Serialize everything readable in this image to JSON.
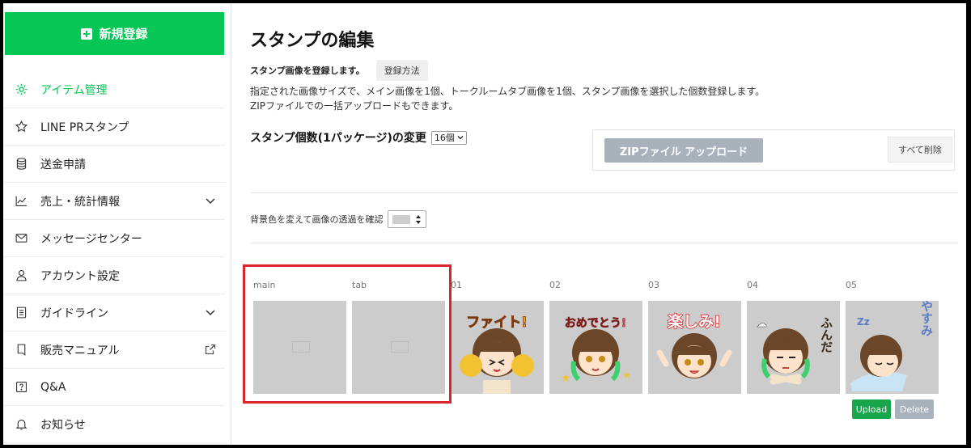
{
  "sidebar": {
    "new_button": "新規登録",
    "items": [
      {
        "label": "アイテム管理",
        "icon": "gear-icon",
        "active": true
      },
      {
        "label": "LINE PRスタンプ",
        "icon": "star-icon"
      },
      {
        "label": "送金申請",
        "icon": "database-icon"
      },
      {
        "label": "売上・統計情報",
        "icon": "chart-icon",
        "trail": "chevron-down-icon"
      },
      {
        "label": "メッセージセンター",
        "icon": "mail-icon"
      },
      {
        "label": "アカウント設定",
        "icon": "person-icon"
      },
      {
        "label": "ガイドライン",
        "icon": "list-doc-icon",
        "trail": "chevron-down-icon"
      },
      {
        "label": "販売マニュアル",
        "icon": "bookmark-icon",
        "trail": "external-link-icon"
      },
      {
        "label": "Q&A",
        "icon": "question-icon"
      },
      {
        "label": "お知らせ",
        "icon": "bell-icon"
      }
    ]
  },
  "main": {
    "title": "スタンプの編集",
    "sub_lead": "スタンプ画像を登録します。",
    "howto_label": "登録方法",
    "desc_line1": "指定された画像サイズで、メイン画像を1個、トークルームタブ画像を1個、スタンプ画像を選択した個数登録します。",
    "desc_line2": "ZIPファイルでの一括アップロードもできます。",
    "count_label": "スタンプ個数(1パッケージ)の変更",
    "count_value": "16個",
    "zip_button": "ZIPファイル アップロード",
    "delete_all_button": "すべて削除",
    "bg_label": "背景色を変えて画像の透過を確認",
    "bg_color": "#cccccc",
    "slots": [
      {
        "label": "main"
      },
      {
        "label": "tab"
      },
      {
        "label": "01",
        "text": "ファイト!"
      },
      {
        "label": "02",
        "text": "おめでとう!"
      },
      {
        "label": "03",
        "text": "楽しみ!"
      },
      {
        "label": "04",
        "text": "ふんだ"
      },
      {
        "label": "05",
        "text": "おやすみ"
      }
    ],
    "upload_button": "Upload",
    "delete_button": "Delete"
  },
  "colors": {
    "brand_green": "#06c755",
    "upload_green": "#19a54b",
    "disabled_gray": "#a9b1bb",
    "highlight_red": "#d9262a",
    "slot_bg": "#cccccc"
  }
}
